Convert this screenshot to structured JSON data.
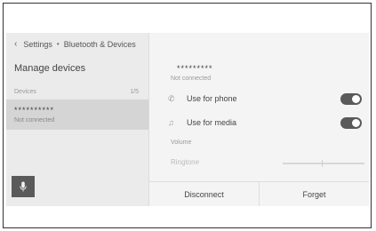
{
  "breadcrumb": {
    "back_icon": "chevron-left-icon",
    "items": [
      "Settings",
      "Bluetooth & Devices"
    ],
    "separator": "•"
  },
  "left_panel": {
    "title": "Manage devices",
    "devices_label": "Devices",
    "devices_count": "1/5",
    "device": {
      "name": "**********",
      "status": "Not connected"
    },
    "mic_icon": "microphone-icon"
  },
  "detail": {
    "device_name": "*********",
    "device_status": "Not connected",
    "options": [
      {
        "icon": "phone-icon",
        "label": "Use for phone",
        "enabled": true
      },
      {
        "icon": "music-note-icon",
        "label": "Use for media",
        "enabled": true
      }
    ],
    "volume_label": "Volume",
    "ringtone_label": "Ringtone",
    "buttons": {
      "disconnect": "Disconnect",
      "forget": "Forget"
    }
  },
  "colors": {
    "toggle_on": "#5a5a5a",
    "selected_row": "#d5d5d5",
    "left_panel_bg": "#ebebeb",
    "screen_bg": "#f4f4f4"
  }
}
